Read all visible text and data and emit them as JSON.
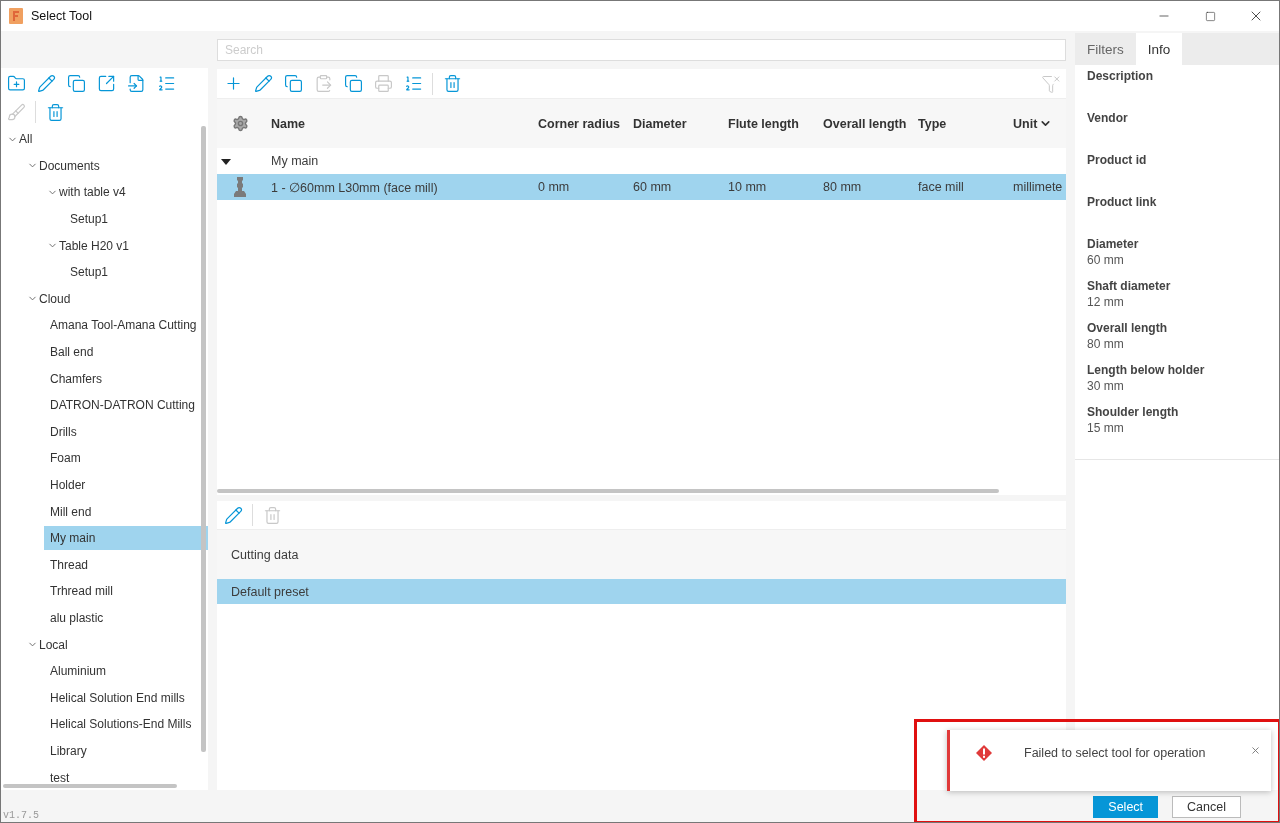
{
  "window": {
    "title": "Select Tool"
  },
  "search": {
    "placeholder": "Search"
  },
  "library_toolbar": [
    {
      "kind": "new-folder",
      "disabled": false
    },
    {
      "kind": "edit",
      "disabled": false
    },
    {
      "kind": "duplicate",
      "disabled": false
    },
    {
      "kind": "export",
      "disabled": false
    },
    {
      "kind": "import",
      "disabled": false
    },
    {
      "kind": "renumber",
      "disabled": false
    },
    {
      "kind": "clean",
      "disabled": true
    },
    {
      "kind": "separator"
    },
    {
      "kind": "delete",
      "disabled": false
    }
  ],
  "tree": [
    {
      "label": "All",
      "expanded": true,
      "selected": false,
      "children": [
        {
          "label": "Documents",
          "expanded": true,
          "selected": false,
          "children": [
            {
              "label": "with table v4",
              "expanded": true,
              "selected": false,
              "children": [
                {
                  "label": "Setup1",
                  "selected": false
                }
              ]
            },
            {
              "label": "Table H20 v1",
              "expanded": true,
              "selected": false,
              "children": [
                {
                  "label": "Setup1",
                  "selected": false
                }
              ]
            }
          ]
        },
        {
          "label": "Cloud",
          "expanded": true,
          "selected": false,
          "children": [
            {
              "label": "Amana Tool-Amana Cutting",
              "selected": false
            },
            {
              "label": "Ball end",
              "selected": false
            },
            {
              "label": "Chamfers",
              "selected": false
            },
            {
              "label": "DATRON-DATRON Cutting",
              "selected": false
            },
            {
              "label": "Drills",
              "selected": false
            },
            {
              "label": "Foam",
              "selected": false
            },
            {
              "label": "Holder",
              "selected": false
            },
            {
              "label": "Mill end",
              "selected": false
            },
            {
              "label": "My main",
              "selected": true
            },
            {
              "label": "Thread",
              "selected": false
            },
            {
              "label": "Trhread mill",
              "selected": false
            },
            {
              "label": "alu plastic",
              "selected": false
            }
          ]
        },
        {
          "label": "Local",
          "expanded": true,
          "selected": false,
          "children": [
            {
              "label": "Aluminium",
              "selected": false
            },
            {
              "label": "Helical Solution End mills",
              "selected": false
            },
            {
              "label": "Helical Solutions-End Mills",
              "selected": false
            },
            {
              "label": "Library",
              "selected": false
            },
            {
              "label": "test",
              "selected": false
            }
          ]
        }
      ]
    }
  ],
  "tool_toolbar": [
    {
      "kind": "add",
      "disabled": false
    },
    {
      "kind": "edit",
      "disabled": false
    },
    {
      "kind": "copy",
      "disabled": false
    },
    {
      "kind": "paste",
      "disabled": true
    },
    {
      "kind": "duplicate",
      "disabled": false
    },
    {
      "kind": "print",
      "disabled": true
    },
    {
      "kind": "renumber",
      "disabled": false
    },
    {
      "kind": "separator"
    },
    {
      "kind": "delete",
      "disabled": false
    }
  ],
  "table": {
    "columns": [
      {
        "label": "Name",
        "sorted": false
      },
      {
        "label": "Corner radius",
        "sorted": false
      },
      {
        "label": "Diameter",
        "sorted": false
      },
      {
        "label": "Flute length",
        "sorted": false
      },
      {
        "label": "Overall length",
        "sorted": false
      },
      {
        "label": "Type",
        "sorted": false
      },
      {
        "label": "Unit",
        "sorted": true
      }
    ],
    "groups": [
      {
        "label": "My main",
        "expanded": true,
        "rows": [
          {
            "selected": true,
            "cells": [
              "1 - ∅60mm L30mm (face mill)",
              "0 mm",
              "60 mm",
              "10 mm",
              "80 mm",
              "face mill",
              "millimete"
            ]
          }
        ]
      }
    ]
  },
  "preset_toolbar": [
    {
      "kind": "edit",
      "disabled": false
    },
    {
      "kind": "separator"
    },
    {
      "kind": "delete",
      "disabled": true
    }
  ],
  "cutting_data": {
    "heading": "Cutting data",
    "presets": [
      {
        "label": "Default preset",
        "selected": true
      }
    ]
  },
  "side_tabs": [
    {
      "label": "Filters",
      "selected": false
    },
    {
      "label": "Info",
      "selected": true
    }
  ],
  "info": [
    {
      "label": "Description"
    },
    {
      "label": "Vendor"
    },
    {
      "label": "Product id"
    },
    {
      "label": "Product link"
    },
    {
      "label": "Diameter",
      "value": "60 mm"
    },
    {
      "label": "Shaft diameter",
      "value": "12 mm"
    },
    {
      "label": "Overall length",
      "value": "80 mm"
    },
    {
      "label": "Length below holder",
      "value": "30 mm"
    },
    {
      "label": "Shoulder length",
      "value": "15 mm"
    }
  ],
  "version": "v1.7.5",
  "buttons": [
    {
      "label": "Select",
      "primary": true
    },
    {
      "label": "Cancel",
      "primary": false
    }
  ],
  "toast": {
    "message": "Failed to select tool for operation"
  }
}
